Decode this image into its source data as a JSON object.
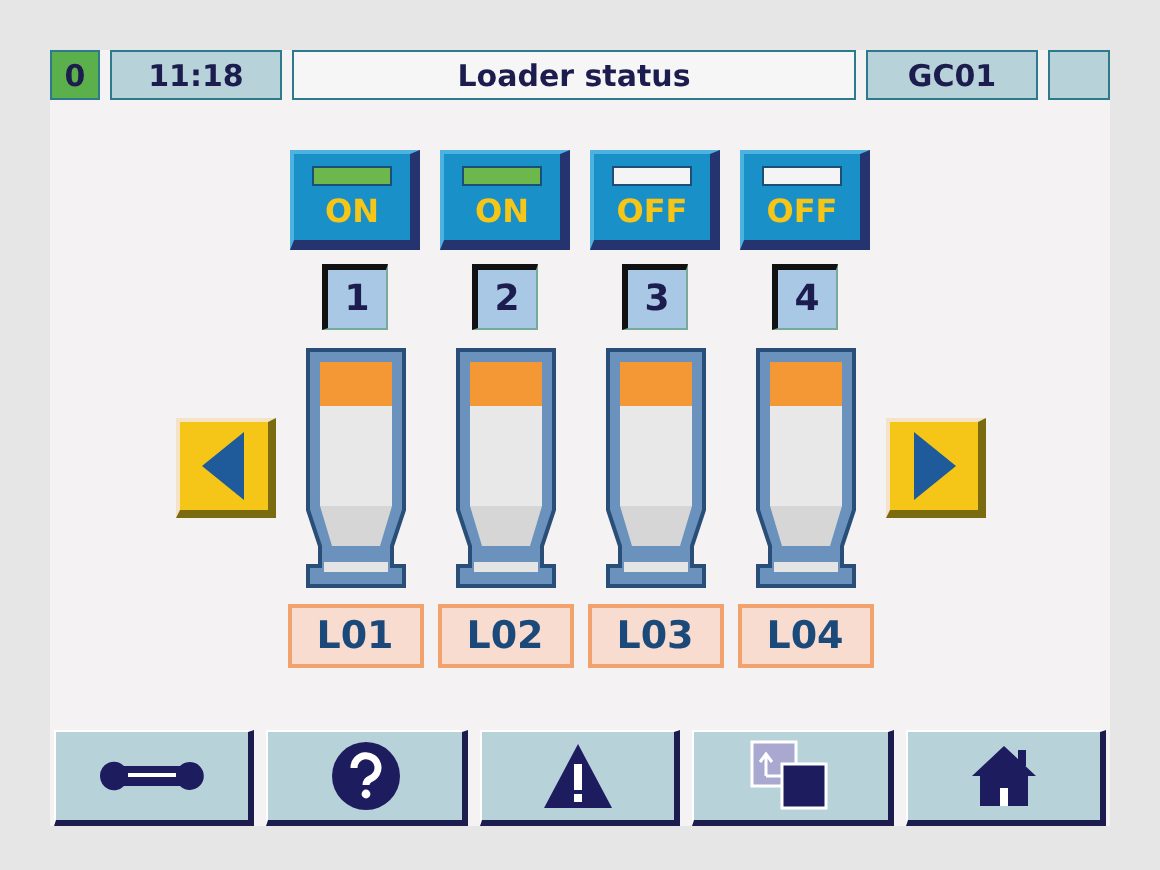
{
  "header": {
    "counter": "0",
    "time": "11:18",
    "title": "Loader status",
    "station": "GC01"
  },
  "loaders": [
    {
      "switch": "ON",
      "on": true,
      "number": "1",
      "label": "L01"
    },
    {
      "switch": "ON",
      "on": true,
      "number": "2",
      "label": "L02"
    },
    {
      "switch": "OFF",
      "on": false,
      "number": "3",
      "label": "L03"
    },
    {
      "switch": "OFF",
      "on": false,
      "number": "4",
      "label": "L04"
    }
  ],
  "footer": [
    {
      "kind": "wrench"
    },
    {
      "kind": "help"
    },
    {
      "kind": "warning"
    },
    {
      "kind": "copy"
    },
    {
      "kind": "home"
    }
  ]
}
